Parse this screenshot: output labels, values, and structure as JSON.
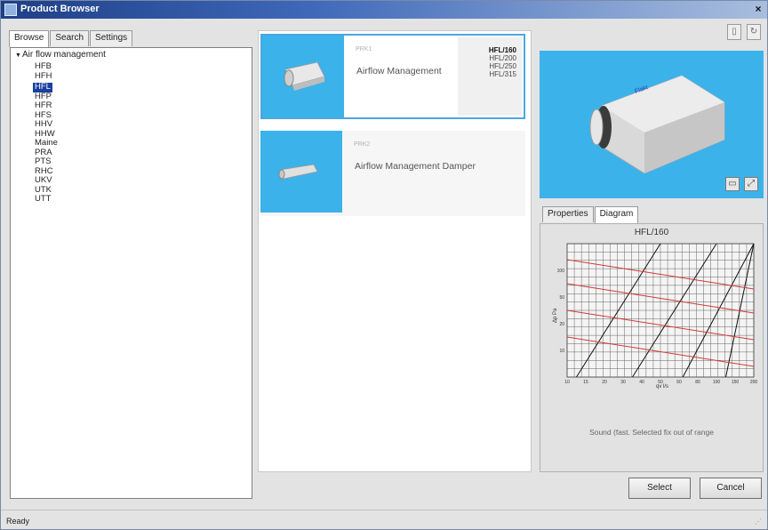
{
  "window": {
    "title": "Product Browser",
    "close_glyph": "×"
  },
  "left_tabs": [
    "Browse",
    "Search",
    "Settings"
  ],
  "tree": {
    "root_label": "Air flow management",
    "items": [
      "HFB",
      "HFH",
      "HFL",
      "HFP",
      "HFR",
      "HFS",
      "HHV",
      "HHW",
      "Maine",
      "PRA",
      "PTS",
      "RHC",
      "UKV",
      "UTK",
      "UTT"
    ],
    "selected_index": 2
  },
  "products": [
    {
      "small_label": "PRK1",
      "name": "Airflow Management",
      "sizes": [
        "HFL/160",
        "HFL/200",
        "HFL/250",
        "HFL/315"
      ],
      "selected_size_index": 0,
      "selected": true
    },
    {
      "small_label": "PRK2",
      "name": "Airflow Management Damper",
      "selected": false
    }
  ],
  "preview": {
    "brand_text": "Flakt",
    "icons": [
      "window-icon",
      "fullscreen-icon"
    ]
  },
  "right_tabs": [
    "Properties",
    "Diagram"
  ],
  "right_active_tab": 1,
  "diagram": {
    "title": "HFL/160",
    "ylabel": "Δp Pa",
    "xlabel": "qv l/s",
    "ytick_labels": [
      "100",
      "50",
      "20",
      "10"
    ],
    "xtick_labels": [
      "10",
      "15",
      "20",
      "30",
      "40",
      "50",
      "60",
      "80",
      "100",
      "150",
      "200"
    ],
    "note": "Sound (fast. Selected fix out of range"
  },
  "buttons": {
    "select": "Select",
    "cancel": "Cancel"
  },
  "status": {
    "text": "Ready"
  },
  "colors": {
    "accent": "#3cb2ea",
    "selection": "#1a3fa0",
    "curve": "#d03a3a"
  }
}
